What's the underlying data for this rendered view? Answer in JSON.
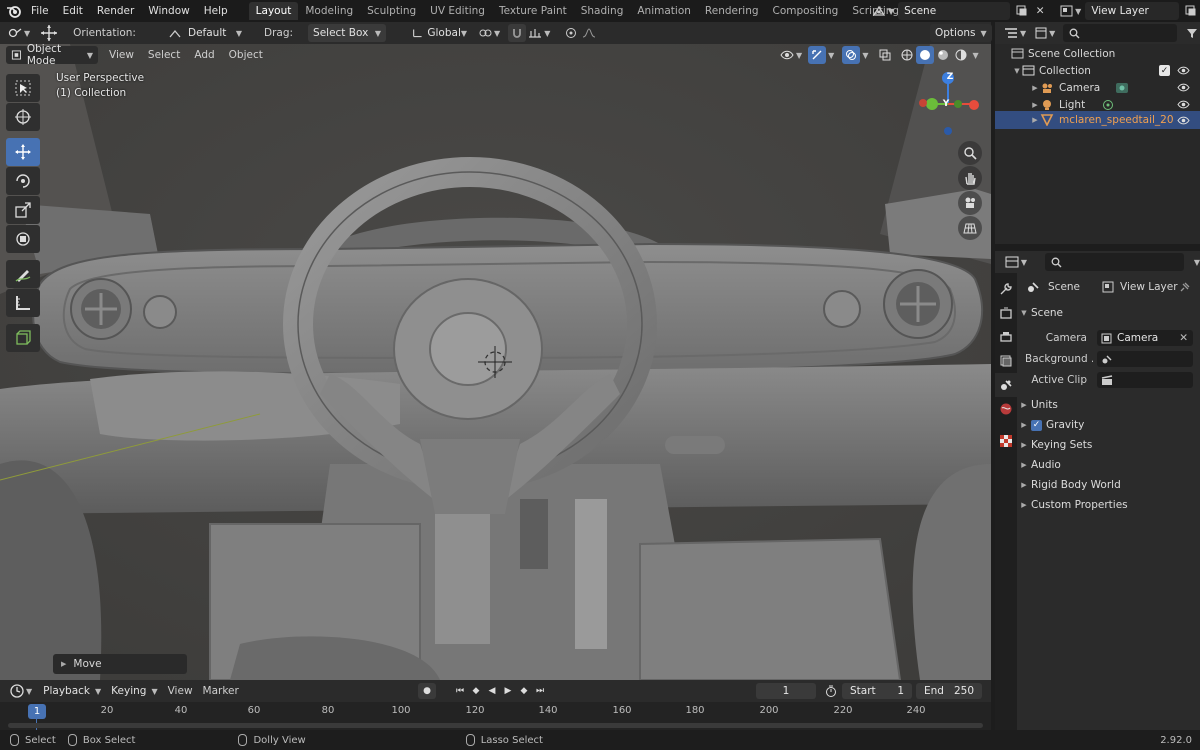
{
  "menu": [
    "File",
    "Edit",
    "Render",
    "Window",
    "Help"
  ],
  "workspaces": [
    {
      "label": "Layout",
      "active": true
    },
    {
      "label": "Modeling"
    },
    {
      "label": "Sculpting"
    },
    {
      "label": "UV Editing"
    },
    {
      "label": "Texture Paint"
    },
    {
      "label": "Shading"
    },
    {
      "label": "Animation"
    },
    {
      "label": "Rendering"
    },
    {
      "label": "Compositing"
    },
    {
      "label": "Scripting"
    }
  ],
  "scene_name": "Scene",
  "view_layer": "View Layer",
  "viewport_header": {
    "orientation_label": "Orientation:",
    "orientation_value": "Default",
    "drag_label": "Drag:",
    "drag_value": "Select Box",
    "transform_orientation": "Global",
    "options": "Options"
  },
  "viewport_header2": {
    "mode": "Object Mode",
    "view": "View",
    "select": "Select",
    "add": "Add",
    "object": "Object"
  },
  "viewport_overlay": {
    "perspective": "User Perspective",
    "collection": "(1) Collection"
  },
  "gizmo": {
    "z": "Z",
    "y": "Y",
    "x_color": "#e74c3c",
    "y_color": "#6bbd3a",
    "z_color": "#3c7fe0"
  },
  "last_operator": "Move",
  "timeline": {
    "playback": "Playback",
    "keying": "Keying",
    "view": "View",
    "marker": "Marker",
    "current_frame": "1",
    "start_label": "Start",
    "start": "1",
    "end_label": "End",
    "end": "250",
    "cursor_frame": "1",
    "ticks": [
      "20",
      "40",
      "60",
      "80",
      "100",
      "120",
      "140",
      "160",
      "180",
      "200",
      "220",
      "240"
    ]
  },
  "statusbar": {
    "select": "Select",
    "box_select": "Box Select",
    "dolly_view": "Dolly View",
    "lasso_select": "Lasso Select",
    "version": "2.92.0"
  },
  "outliner": {
    "scene_collection": "Scene Collection",
    "collection": "Collection",
    "items": [
      {
        "name": "Camera"
      },
      {
        "name": "Light"
      },
      {
        "name": "mclaren_speedtail_20",
        "selected": true
      }
    ]
  },
  "properties": {
    "breadcrumb_scene": "Scene",
    "breadcrumb_view_layer": "View Layer",
    "panel_title": "Scene",
    "camera_label": "Camera",
    "camera_value": "Camera",
    "background_label": "Background ...",
    "active_clip_label": "Active Clip",
    "sections": [
      "Units",
      "Gravity",
      "Keying Sets",
      "Audio",
      "Rigid Body World",
      "Custom Properties"
    ]
  },
  "colors": {
    "accent": "#4772b3",
    "selected_text": "#f0a050",
    "header": "#2b2b2b",
    "panel": "#282828"
  }
}
